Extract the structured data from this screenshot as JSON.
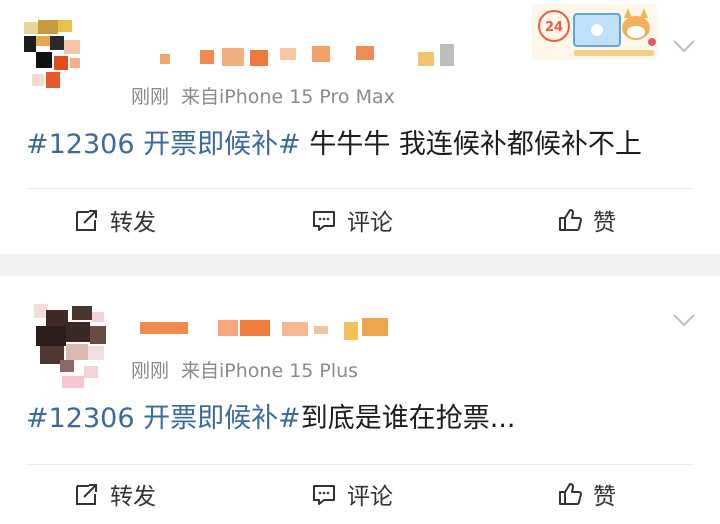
{
  "posts": [
    {
      "time": "刚刚",
      "source": "来自iPhone 15 Pro Max",
      "topic": "#12306 开票即候补#",
      "text": " 牛牛牛 我连候补都候补不上",
      "actions": {
        "repost": "转发",
        "comment": "评论",
        "like": "赞"
      },
      "badge_icon": "24hr-cat-computer-sticker",
      "badge_text": "24"
    },
    {
      "time": "刚刚",
      "source": "来自iPhone 15 Plus",
      "topic": "#12306 开票即候补#",
      "text": "到底是谁在抢票...",
      "actions": {
        "repost": "转发",
        "comment": "评论",
        "like": "赞"
      }
    }
  ],
  "colors": {
    "topic": "#3b6aa0",
    "meta": "#8a8a8a",
    "separator": "#f2f2f2"
  }
}
